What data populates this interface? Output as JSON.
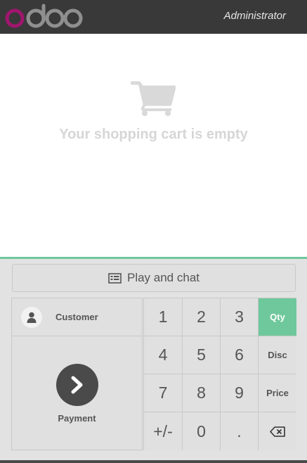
{
  "header": {
    "logo_text": "odoo",
    "user_name": "Administrator"
  },
  "cart": {
    "icon": "shopping-cart-icon",
    "empty_message": "Your shopping cart is empty"
  },
  "controls": {
    "play_chat_label": "Play and chat",
    "play_chat_icon": "list-card-icon",
    "customer_label": "Customer",
    "customer_icon": "user-icon",
    "payment_label": "Payment",
    "payment_icon": "chevron-right-icon"
  },
  "numpad": {
    "k1": "1",
    "k2": "2",
    "k3": "3",
    "qty": "Qty",
    "k4": "4",
    "k5": "5",
    "k6": "6",
    "disc": "Disc",
    "k7": "7",
    "k8": "8",
    "k9": "9",
    "price": "Price",
    "sign": "+/-",
    "k0": "0",
    "dot": ".",
    "backspace_icon": "backspace-icon",
    "active_mode": "Qty"
  },
  "colors": {
    "topbar": "#393939",
    "accent": "#6ec89b",
    "logo_magenta": "#a0166e",
    "logo_grey": "#8f8f8f"
  }
}
